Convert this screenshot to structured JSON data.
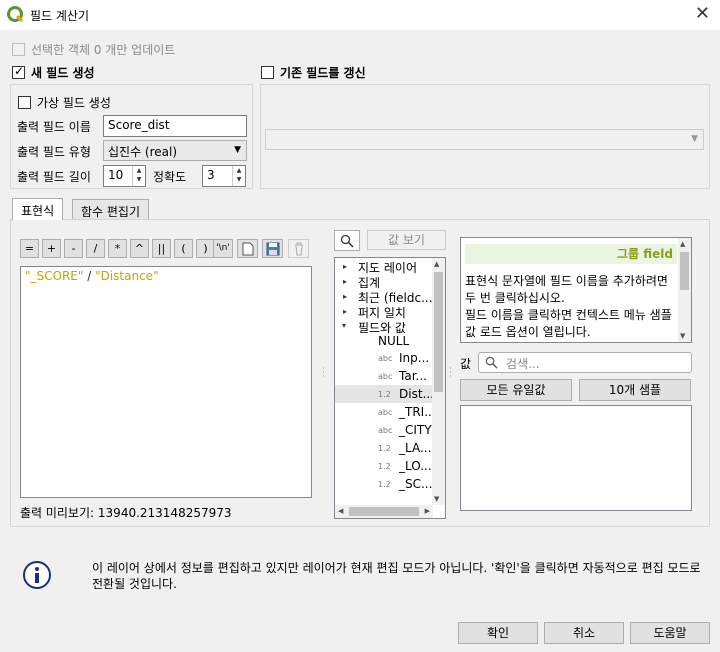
{
  "window": {
    "title": "필드 계산기",
    "close_glyph": "✕"
  },
  "update_selected": "선택한 객체 0 개만 업데이트",
  "new_field": {
    "label": "새 필드 생성",
    "virtual": "가상 필드 생성",
    "name_label": "출력 필드 이름",
    "name_value": "Score_dist",
    "type_label": "출력 필드 유형",
    "type_value": "십진수 (real)",
    "length_label": "출력 필드 길이",
    "length_value": "10",
    "precision_label": "정확도",
    "precision_value": "3"
  },
  "update_existing": {
    "label": "기존 필드를 갱신"
  },
  "tabs": [
    "표현식",
    "함수 편집기"
  ],
  "operators": [
    "=",
    "+",
    "-",
    "/",
    "*",
    "^",
    "||",
    "(",
    ")",
    "'\\n'"
  ],
  "expression": {
    "part1": "\"_SCORE\"",
    "op": " / ",
    "part2": "\"Distance\""
  },
  "preview": "출력 미리보기: 13940.213148257973",
  "function_list": {
    "show_values": "값 보기",
    "items": [
      {
        "label": "지도 레이어",
        "arrow": "▸"
      },
      {
        "label": "집계",
        "arrow": "▸"
      },
      {
        "label": "최근 (fieldc...",
        "arrow": "▸"
      },
      {
        "label": "퍼지 일치",
        "arrow": "▸"
      },
      {
        "label": "필드와 값",
        "arrow": "▾"
      }
    ],
    "fields": [
      {
        "tag": "",
        "label": "NULL"
      },
      {
        "tag": "abc",
        "label": "Inp..."
      },
      {
        "tag": "abc",
        "label": "Tar..."
      },
      {
        "tag": "1.2",
        "label": "Dist..."
      },
      {
        "tag": "abc",
        "label": "_TRI..."
      },
      {
        "tag": "abc",
        "label": "_CITY"
      },
      {
        "tag": "1.2",
        "label": "_LA..."
      },
      {
        "tag": "1.2",
        "label": "_LO..."
      },
      {
        "tag": "1.2",
        "label": "_SC..."
      }
    ]
  },
  "help": {
    "header": "그룹 field",
    "body": "표현식 문자열에 필드 이름을 추가하려면 두 번 클릭하십시오.\n필드 이름을 클릭하면 컨텍스트 메뉴 샘플 값 로드 옵션이 열립니다."
  },
  "values": {
    "label": "값",
    "search_placeholder": "검색...",
    "all_unique": "모든 유일값",
    "sample_10": "10개 샘플"
  },
  "info_message": "이 레이어 상에서 정보를 편집하고 있지만 레이어가 현재 편집 모드가 아닙니다. '확인'을 클릭하면 자동적으로 편집 모드로 전환될 것입니다.",
  "buttons": {
    "ok": "확인",
    "cancel": "취소",
    "help": "도움말"
  },
  "colors": {
    "field_string": "#c8a000",
    "help_header_bg": "#eaf4e0",
    "help_header_fg": "#8b9e1a"
  }
}
